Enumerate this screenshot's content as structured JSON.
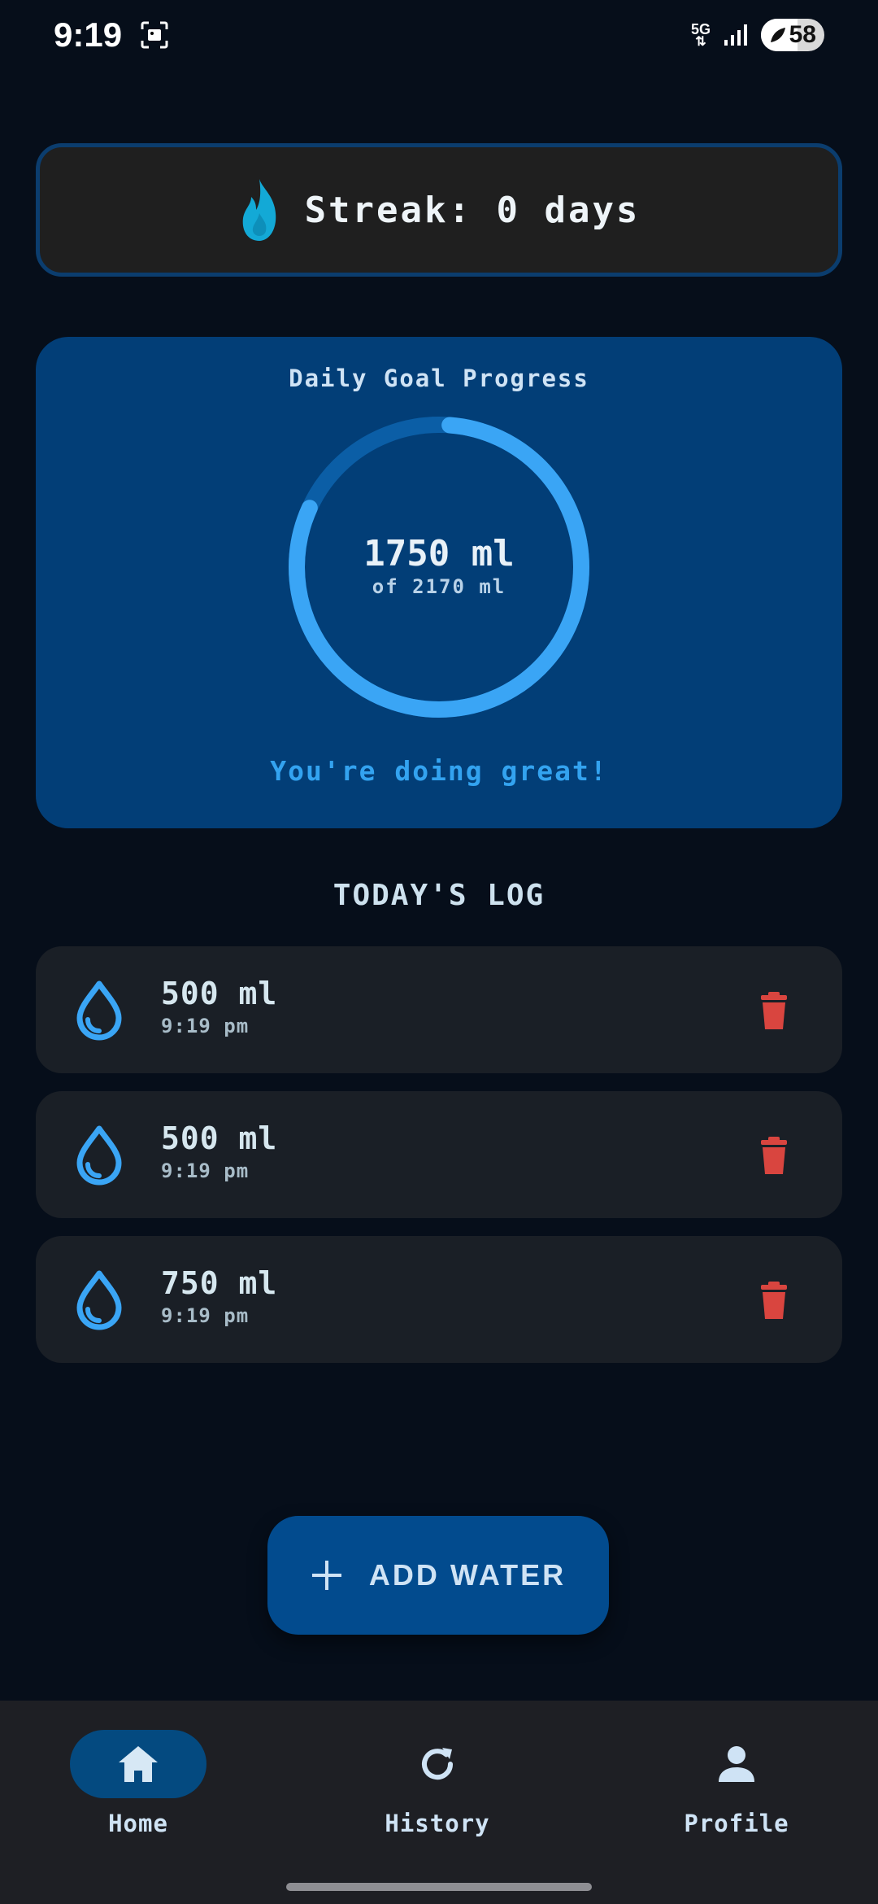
{
  "status_bar": {
    "time": "9:19",
    "network": "5G",
    "battery_level": "58",
    "battery_fraction": 0.58
  },
  "streak": {
    "icon": "flame-icon",
    "text": "Streak: 0 days"
  },
  "progress": {
    "title": "Daily Goal Progress",
    "value": "1750 ml",
    "goal": "of 2170 ml",
    "fraction": 0.806,
    "message": "You're doing great!",
    "colors": {
      "ring": "#3aa5f5",
      "track": "#0b5ea6"
    }
  },
  "log": {
    "title": "TODAY'S LOG",
    "items": [
      {
        "amount": "500 ml",
        "time": "9:19 pm",
        "icon": "water-drop-icon"
      },
      {
        "amount": "500 ml",
        "time": "9:19 pm",
        "icon": "water-drop-icon"
      },
      {
        "amount": "750 ml",
        "time": "9:19 pm",
        "icon": "water-drop-icon"
      }
    ],
    "delete_color": "#d9453f"
  },
  "add_button": {
    "icon": "plus-icon",
    "label": "ADD WATER"
  },
  "nav": {
    "items": [
      {
        "label": "Home",
        "icon": "home-icon",
        "active": true
      },
      {
        "label": "History",
        "icon": "history-icon",
        "active": false
      },
      {
        "label": "Profile",
        "icon": "person-icon",
        "active": false
      }
    ]
  }
}
